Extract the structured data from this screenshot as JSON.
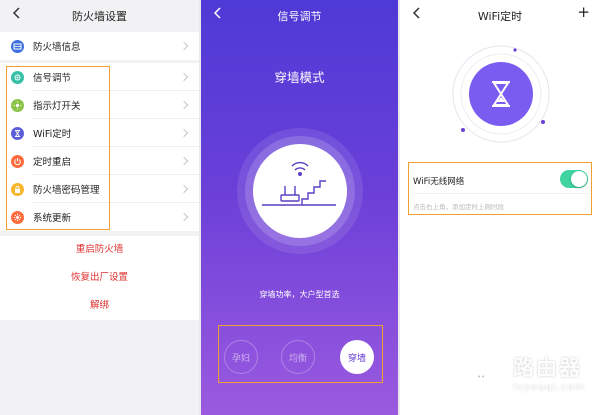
{
  "firewall": {
    "title": "防火墙设置",
    "info": {
      "label": "防火墙信息",
      "icon": "firewall-info-icon",
      "color": "#3b6fe0"
    },
    "items": [
      {
        "label": "信号调节",
        "icon": "signal-icon",
        "color": "#36c0a8"
      },
      {
        "label": "指示灯开关",
        "icon": "indicator-light-icon",
        "color": "#8bc34a"
      },
      {
        "label": "WiFi定时",
        "icon": "wifi-timer-icon",
        "color": "#5c5ed8"
      },
      {
        "label": "定时重启",
        "icon": "power-icon",
        "color": "#ff6a3d"
      },
      {
        "label": "防火墙密码管理",
        "icon": "lock-icon",
        "color": "#f7b52c"
      },
      {
        "label": "系统更新",
        "icon": "update-icon",
        "color": "#ff6a3d"
      }
    ],
    "actions": [
      "重启防火墙",
      "恢复出厂设置",
      "解绑"
    ]
  },
  "signal": {
    "title": "信号调节",
    "mode_title": "穿墙模式",
    "description": "穿墙功率，大户型首选",
    "modes": [
      "孕妇",
      "均衡",
      "穿墙"
    ],
    "active_mode": "穿墙"
  },
  "wifi_timer": {
    "title": "WiFi定时",
    "add_label": "+",
    "toggle_label": "WiFi无线网络",
    "toggle_on": true,
    "hint": "点击右上角，添加定时上网时段"
  },
  "watermark": {
    "title": "路由器",
    "domain": "luyouqi.com"
  },
  "colors": {
    "accent": "#6a3fd8",
    "toggle": "#3fd4a0",
    "highlight": "#f0a030",
    "danger": "#e03030"
  }
}
